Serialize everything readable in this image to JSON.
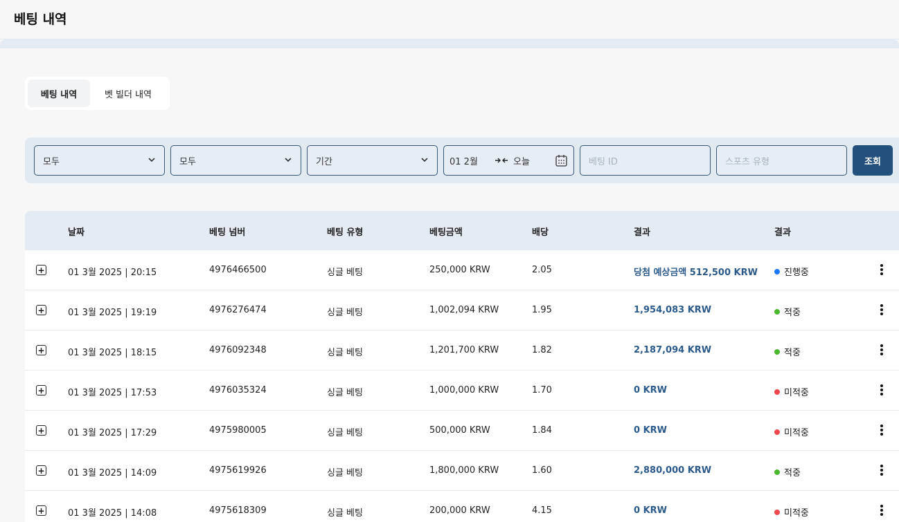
{
  "header": {
    "title": "베팅 내역"
  },
  "tabs": [
    {
      "label": "베팅 내역",
      "active": true
    },
    {
      "label": "벳 빌더 내역",
      "active": false
    }
  ],
  "filters": {
    "select1": "모두",
    "select2": "모두",
    "period": "기간",
    "date_from": "01 2월",
    "date_to": "오늘",
    "bet_id_placeholder": "베팅 ID",
    "sport_placeholder": "스포츠 유형",
    "search_label": "조회"
  },
  "table": {
    "columns": [
      "날짜",
      "베팅 넘버",
      "베팅 유형",
      "베팅금액",
      "배당",
      "결과",
      "결과"
    ],
    "rows": [
      {
        "date": "01 3월 2025 | 20:15",
        "number": "4976466500",
        "type": "싱글 베팅",
        "amount": "250,000 KRW",
        "odds": "2.05",
        "result": "당첨 예상금액 512,500 KRW",
        "status": "진행중",
        "status_color": "#1e78ff"
      },
      {
        "date": "01 3월 2025 | 19:19",
        "number": "4976276474",
        "type": "싱글 베팅",
        "amount": "1,002,094 KRW",
        "odds": "1.95",
        "result": "1,954,083 KRW",
        "status": "적중",
        "status_color": "#4bb82e"
      },
      {
        "date": "01 3월 2025 | 18:15",
        "number": "4976092348",
        "type": "싱글 베팅",
        "amount": "1,201,700 KRW",
        "odds": "1.82",
        "result": "2,187,094 KRW",
        "status": "적중",
        "status_color": "#4bb82e"
      },
      {
        "date": "01 3월 2025 | 17:53",
        "number": "4976035324",
        "type": "싱글 베팅",
        "amount": "1,000,000 KRW",
        "odds": "1.70",
        "result": "0 KRW",
        "status": "미적중",
        "status_color": "#f0474e"
      },
      {
        "date": "01 3월 2025 | 17:29",
        "number": "4975980005",
        "type": "싱글 베팅",
        "amount": "500,000 KRW",
        "odds": "1.84",
        "result": "0 KRW",
        "status": "미적중",
        "status_color": "#f0474e"
      },
      {
        "date": "01 3월 2025 | 14:09",
        "number": "4975619926",
        "type": "싱글 베팅",
        "amount": "1,800,000 KRW",
        "odds": "1.60",
        "result": "2,880,000 KRW",
        "status": "적중",
        "status_color": "#4bb82e"
      },
      {
        "date": "01 3월 2025 | 14:08",
        "number": "4975618309",
        "type": "싱글 베팅",
        "amount": "200,000 KRW",
        "odds": "4.15",
        "result": "0 KRW",
        "status": "미적중",
        "status_color": "#f0474e"
      }
    ]
  }
}
